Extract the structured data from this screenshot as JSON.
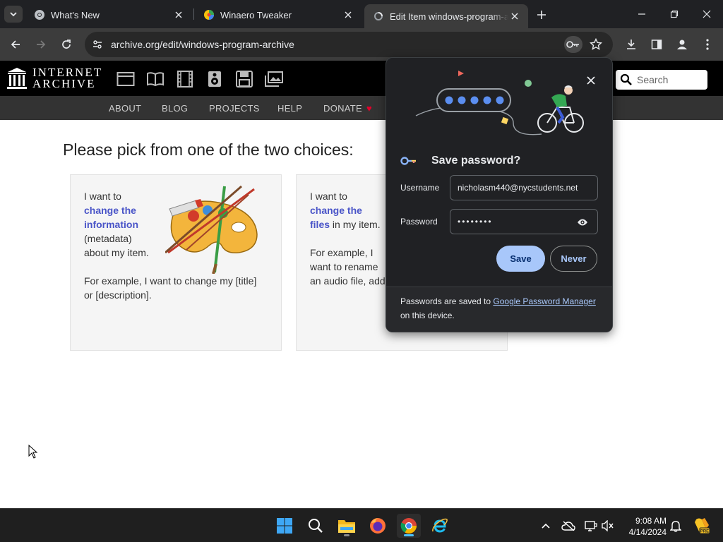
{
  "browser": {
    "tabs": [
      {
        "title": "What's New",
        "icon": "chrome-icon"
      },
      {
        "title": "Winaero Tweaker",
        "icon": "winaero-icon"
      },
      {
        "title": "Edit Item windows-program-archive",
        "icon": "loading-icon",
        "active": true
      }
    ],
    "url": "archive.org/edit/windows-program-archive"
  },
  "site": {
    "logo_line1": "INTERNET",
    "logo_line2": "ARCHIVE",
    "media_icons": [
      "web-icon",
      "texts-icon",
      "video-icon",
      "audio-icon",
      "software-icon",
      "images-icon"
    ],
    "search_placeholder": "Search",
    "nav": [
      "ABOUT",
      "BLOG",
      "PROJECTS",
      "HELP",
      "DONATE"
    ]
  },
  "page": {
    "heading": "Please pick from one of the two choices:",
    "card1": {
      "l1": "I want to",
      "link1": "change the",
      "link2": "information",
      "l2": "(metadata)",
      "l3": "about my item.",
      "l4": "For example, I want to change my [title]",
      "l5": "or [description]."
    },
    "card2": {
      "l1": "I want to",
      "link1": "change the",
      "link2": "files",
      "l2suffix": " in my item.",
      "l3": "For example, I",
      "l4": "want to rename",
      "l5": "an audio file, add"
    }
  },
  "password_bubble": {
    "title": "Save password?",
    "username_label": "Username",
    "username_value": "nicholasm440@nycstudents.net",
    "password_label": "Password",
    "password_value": "••••••••",
    "save_label": "Save",
    "never_label": "Never",
    "footer_prefix": "Passwords are saved to ",
    "footer_link": "Google Password Manager",
    "footer_suffix": "on this device."
  },
  "taskbar": {
    "apps": [
      "windows-start-icon",
      "search-icon",
      "file-explorer-icon",
      "firefox-icon",
      "chrome-icon",
      "internet-explorer-icon"
    ],
    "time": "9:08 AM",
    "date": "4/14/2024"
  },
  "colors": {
    "chrome_dark": "#202124",
    "toolbar": "#3c3c3c",
    "ia_black": "#000000",
    "accent_blue": "#a8c7fa",
    "link_purple": "#4a55c8"
  }
}
